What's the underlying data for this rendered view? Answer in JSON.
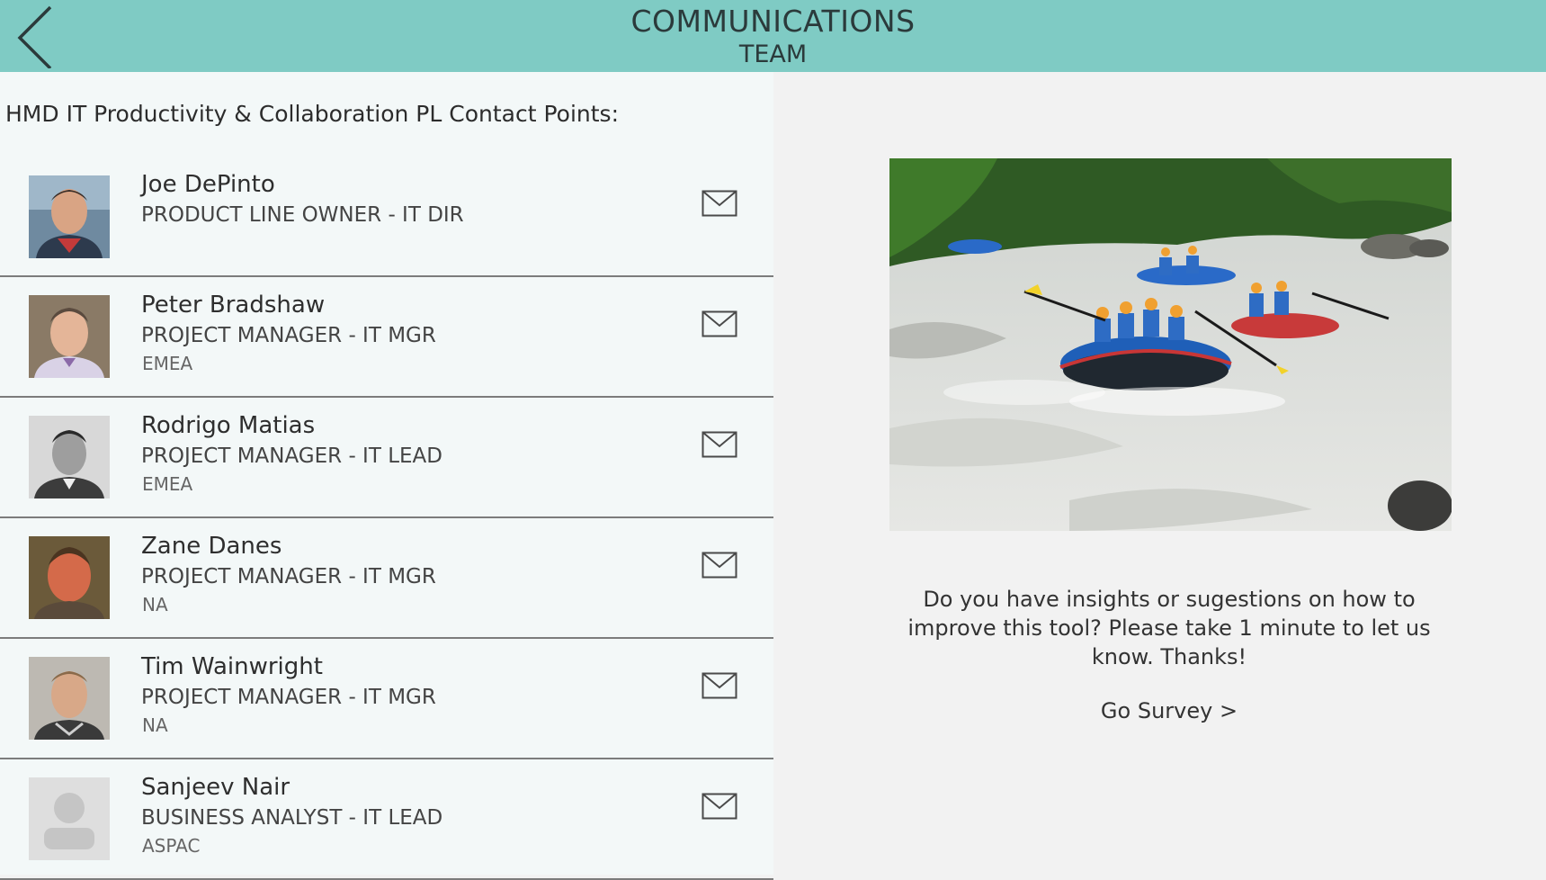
{
  "header": {
    "title": "COMMUNICATIONS",
    "subtitle": "TEAM",
    "background_color": "#7fcbc4"
  },
  "section_title": "HMD IT Productivity & Collaboration PL Contact Points:",
  "contacts": [
    {
      "name": "Joe DePinto",
      "role": "PRODUCT LINE OWNER - IT DIR",
      "region": "",
      "icon": "mail-icon"
    },
    {
      "name": "Peter Bradshaw",
      "role": "PROJECT MANAGER - IT MGR",
      "region": "EMEA",
      "icon": "mail-icon"
    },
    {
      "name": "Rodrigo Matias",
      "role": "PROJECT MANAGER - IT LEAD",
      "region": "EMEA",
      "icon": "mail-icon"
    },
    {
      "name": "Zane Danes",
      "role": "PROJECT MANAGER - IT MGR",
      "region": "NA",
      "icon": "mail-icon"
    },
    {
      "name": "Tim Wainwright",
      "role": "PROJECT MANAGER - IT MGR",
      "region": "NA",
      "icon": "mail-icon"
    },
    {
      "name": "Sanjeev Nair",
      "role": "BUSINESS ANALYST - IT LEAD",
      "region": "ASPAC",
      "icon": "mail-icon"
    }
  ],
  "survey": {
    "text": "Do you have insights or sugestions on how to improve this tool? Please take 1 minute to let us know. Thanks!",
    "link_label": "Go Survey >"
  }
}
